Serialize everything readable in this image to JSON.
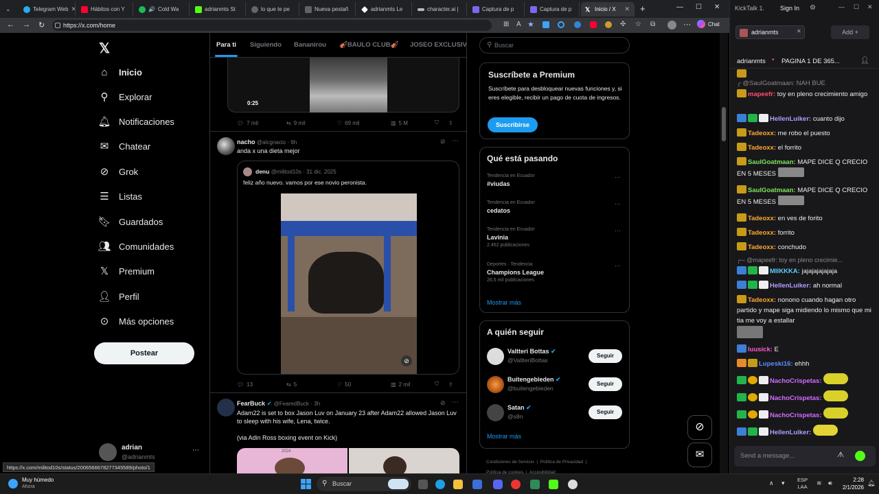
{
  "browser": {
    "tabs": [
      {
        "label": "Telegram Web",
        "color": "#2aabee"
      },
      {
        "label": "Hábitos con Y",
        "color": "#ff0033"
      },
      {
        "label": "Cold Wa",
        "color": "#1db954"
      },
      {
        "label": "adrianmts St",
        "color": "#53fc18"
      },
      {
        "label": "lo que te pe",
        "color": "#888888"
      },
      {
        "label": "Nueva pestañ",
        "color": "#5f6368"
      },
      {
        "label": "adrianmts Le",
        "color": "#ffffff"
      },
      {
        "label": "character.ai |",
        "color": "#bbbbbb"
      },
      {
        "label": "Captura de p",
        "color": "#7b68ee"
      },
      {
        "label": "Captura de p",
        "color": "#7b68ee"
      },
      {
        "label": "Inicio / X",
        "color": "#ffffff"
      }
    ],
    "url": "https://x.com/home",
    "chat_label": "Chat",
    "status_url": "https://x.com/militod10s/status/2006566678277345589/photo/1"
  },
  "x_nav": {
    "items": [
      "Inicio",
      "Explorar",
      "Notificaciones",
      "Chatear",
      "Grok",
      "Listas",
      "Guardados",
      "Comunidades",
      "Premium",
      "Perfil",
      "Más opciones"
    ],
    "post_label": "Postear",
    "account_name": "adrian",
    "account_handle": "@adrianmts"
  },
  "feed": {
    "tabs": [
      "Para ti",
      "Siguiendo",
      "Bananirou",
      "🎻BAULO CLUB🎻",
      "JOSEO EXCLUSIVE"
    ],
    "post0": {
      "video_time": "0:25",
      "replies": "7 mil",
      "reposts": "9 mil",
      "likes": "69 mil",
      "views": "5 M"
    },
    "post1": {
      "name": "nacho",
      "handle": "@alcgnacio",
      "time": "· 6h",
      "text": "anda x una dieta mejor",
      "quote_name": "denu",
      "quote_handle": "@militod10s",
      "quote_time": "· 31 dic. 2025",
      "quote_text": "feliz año nuevo. vamos por ese novio peronista.",
      "replies": "13",
      "reposts": "5",
      "likes": "50",
      "views": "2 mil"
    },
    "post2": {
      "name": "FearBuck",
      "handle": "@FearedBuck",
      "time": "· 3h",
      "text": "Adam22 is set to box Jason Luv on January 23 after Adam22 allowed Jason Luv to sleep with his wife, Lena, twice.",
      "text2": "(via Adin Ross boxing event on Kick)",
      "photo_text": "2024"
    }
  },
  "right": {
    "search_placeholder": "Buscar",
    "premium_title": "Suscríbete a Premium",
    "premium_text": "Suscríbete para desbloquear nuevas funciones y, si eres elegible, recibir un pago de cuota de ingresos.",
    "premium_button": "Suscribirse",
    "trends_title": "Qué está pasando",
    "trends": [
      {
        "meta": "Tendencia en Ecuador",
        "name": "#viudas",
        "count": ""
      },
      {
        "meta": "Tendencia en Ecuador",
        "name": "cedatos",
        "count": ""
      },
      {
        "meta": "Tendencia en Ecuador",
        "name": "Lavinia",
        "count": "2.462 publicaciones"
      },
      {
        "meta": "Deportes · Tendencia",
        "name": "Champions League",
        "count": "26,5 mil publicaciones"
      }
    ],
    "show_more": "Mostrar más",
    "follow_title": "A quién seguir",
    "follow": [
      {
        "name": "Valtteri Bottas",
        "handle": "@ValtteriBottas"
      },
      {
        "name": "Buitengebieden",
        "handle": "@buitengebieden"
      },
      {
        "name": "Satan",
        "handle": "@s8n"
      }
    ],
    "follow_label": "Seguir",
    "footer": [
      "Condiciones de Servicio",
      "Política de Privacidad",
      "Política de cookies",
      "Accesibilidad"
    ]
  },
  "kick": {
    "app_title": "KickTalk 1.",
    "sign_in": "Sign In",
    "channel": "adrianmts",
    "add_label": "Add",
    "header_name": "adrianmts",
    "header_title": "PAGINA 1 DE 365...",
    "messages": [
      {
        "user": "",
        "text": "cuanto"
      },
      {
        "user": "",
        "text": "@SaulGoatmaan: NAH BUE"
      },
      {
        "user": "mapeefr:",
        "text": "toy en pleno crecimiento amigo",
        "color": "#ff4d6d"
      },
      {
        "user": "HellenLuiker:",
        "text": "cuanto dijo",
        "color": "#b39dff"
      },
      {
        "user": "Tadeoxx:",
        "text": "me robo el puesto",
        "color": "#ffa733"
      },
      {
        "user": "Tadeoxx:",
        "text": "el forrito",
        "color": "#ffa733"
      },
      {
        "user": "SaulGoatmaan:",
        "text": "MAPE DICE Q CRECIO EN 5 MESES",
        "color": "#7ce35a"
      },
      {
        "user": "SaulGoatmaan:",
        "text": "MAPE DICE Q CRECIO EN 5 MESES",
        "color": "#7ce35a"
      },
      {
        "user": "Tadeoxx:",
        "text": "en ves de forito",
        "color": "#ffa733"
      },
      {
        "user": "Tadeoxx:",
        "text": "forrito",
        "color": "#ffa733"
      },
      {
        "user": "Tadeoxx:",
        "text": "conchudo",
        "color": "#ffa733"
      },
      {
        "user": "",
        "text": "@mapeefr: toy en pleno crecimie..."
      },
      {
        "user": "MIIKKKA:",
        "text": "jajajajajajaja",
        "color": "#5ad1ff"
      },
      {
        "user": "HellenLuiker:",
        "text": "ah normal",
        "color": "#b39dff"
      },
      {
        "user": "Tadeoxx:",
        "text": "nonono cuando hagan otro partido y mape siga midiendo lo mismo que mi tia me voy a estallar",
        "color": "#ffa733"
      },
      {
        "user": "luusick:",
        "text": "E",
        "color": "#ff5ad1"
      },
      {
        "user": "Lupeski16:",
        "text": "ehhh",
        "color": "#5a8cff"
      },
      {
        "user": "NachoCrispetas:",
        "text": "",
        "color": "#d46bff"
      },
      {
        "user": "NachoCrispetas:",
        "text": "",
        "color": "#d46bff"
      },
      {
        "user": "NachoCrispetas:",
        "text": "",
        "color": "#d46bff"
      },
      {
        "user": "HellenLuiker:",
        "text": "",
        "color": "#b39dff"
      }
    ],
    "input_placeholder": "Send a message..."
  },
  "taskbar": {
    "weather_title": "Muy húmedo",
    "weather_sub": "Ahora",
    "search": "Buscar",
    "lang": "ESP",
    "lang2": "LAA",
    "time": "2:28",
    "date": "2/1/2026"
  }
}
